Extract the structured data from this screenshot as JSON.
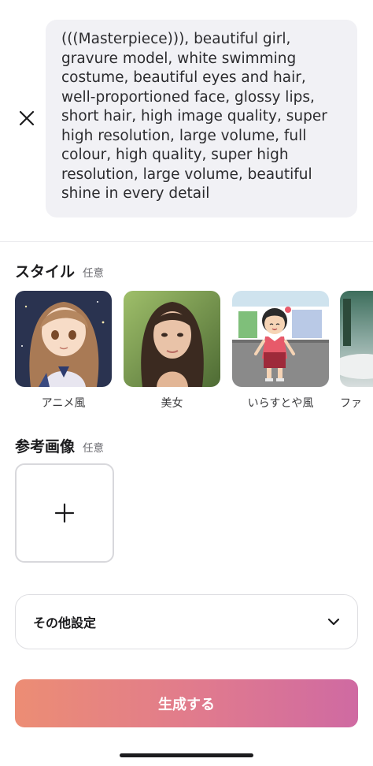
{
  "prompt": {
    "text": "(((Masterpiece))), beautiful girl, gravure model, white swimming costume, beautiful eyes and hair, well-proportioned face, glossy lips, short hair, high image quality, super high resolution, large volume, full colour, high quality, super high resolution, large volume, beautiful shine in every detail",
    "close_icon": "close-icon"
  },
  "style_section": {
    "title": "スタイル",
    "tag": "任意",
    "items": [
      {
        "label": "アニメ風"
      },
      {
        "label": "美女"
      },
      {
        "label": "いらすとや風"
      },
      {
        "label": "ファ"
      }
    ]
  },
  "reference_section": {
    "title": "参考画像",
    "tag": "任意",
    "add_icon": "plus-icon"
  },
  "settings": {
    "label": "その他設定",
    "icon": "chevron-down-icon"
  },
  "generate": {
    "label": "生成する",
    "gradient_start": "#ec8d74",
    "gradient_end": "#cf6aa2"
  }
}
